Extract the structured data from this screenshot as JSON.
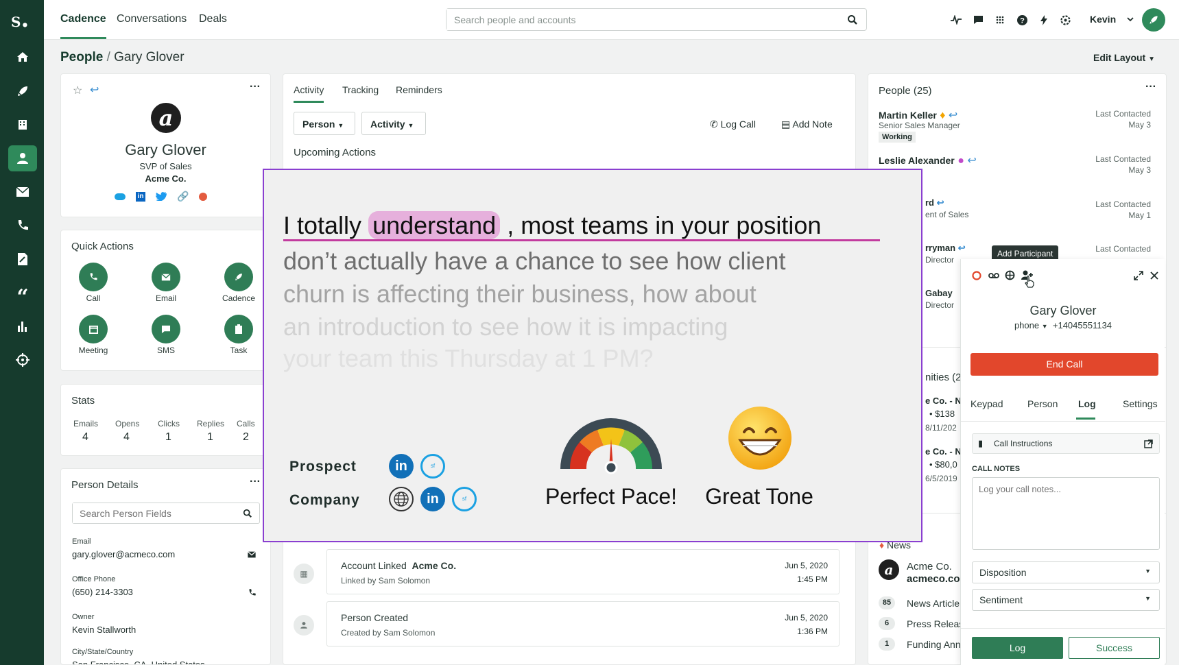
{
  "brand": {
    "logo": "S",
    "accent": "#2f8a5b",
    "sidebar": "#163b2d"
  },
  "topnav": {
    "tabs": [
      "Cadence",
      "Conversations",
      "Deals"
    ],
    "search_placeholder": "Search people and accounts",
    "user": "Kevin"
  },
  "breadcrumb": {
    "root": "People",
    "sep": "/",
    "current": "Gary Glover"
  },
  "edit_layout": "Edit Layout",
  "profile": {
    "name": "Gary Glover",
    "title": "SVP of Sales",
    "company": "Acme Co."
  },
  "quick_actions": {
    "title": "Quick Actions",
    "items": [
      "Call",
      "Email",
      "Cadence",
      "Meeting",
      "SMS",
      "Task"
    ]
  },
  "stats": {
    "title": "Stats",
    "items": [
      {
        "label": "Emails",
        "value": "4"
      },
      {
        "label": "Opens",
        "value": "4"
      },
      {
        "label": "Clicks",
        "value": "1"
      },
      {
        "label": "Replies",
        "value": "1"
      },
      {
        "label": "Calls",
        "value": "2"
      }
    ]
  },
  "person_details": {
    "title": "Person Details",
    "search_placeholder": "Search Person Fields",
    "fields": [
      {
        "label": "Email",
        "value": "gary.glover@acmeco.com"
      },
      {
        "label": "Office Phone",
        "value": "(650) 214-3303"
      },
      {
        "label": "Owner",
        "value": "Kevin Stallworth"
      },
      {
        "label": "City/State/Country",
        "value": "San Francisco, CA, United States"
      }
    ]
  },
  "activity": {
    "tabs": [
      "Activity",
      "Tracking",
      "Reminders"
    ],
    "filters": [
      "Person",
      "Activity"
    ],
    "log_call": "Log Call",
    "add_note": "Add Note",
    "upcoming": "Upcoming Actions",
    "feed": [
      {
        "title": "Account Linked",
        "entity": "Acme Co.",
        "sub": "Linked by Sam Solomon",
        "date": "Jun 5, 2020",
        "time": "1:45 PM"
      },
      {
        "title": "Person Created",
        "entity": "",
        "sub": "Created by Sam Solomon",
        "date": "Jun 5, 2020",
        "time": "1:36 PM"
      }
    ]
  },
  "people": {
    "title": "People (25)",
    "last_contacted": "Last Contacted",
    "items": [
      {
        "name": "Martin Keller",
        "role": "Senior Sales Manager",
        "badge": "Working",
        "date": "May 3"
      },
      {
        "name": "Leslie Alexander",
        "role": "",
        "badge": "",
        "date": "May 3"
      },
      {
        "name": "rd",
        "role": "ent of Sales",
        "badge": "",
        "date": "May 1"
      },
      {
        "name": "rryman",
        "role": "Director",
        "badge": "",
        "date": ""
      },
      {
        "name": "Gabay",
        "role": "Director",
        "badge": "",
        "date": ""
      }
    ]
  },
  "opps": {
    "title": "nities (2)",
    "items": [
      {
        "name": "e Co. - N",
        "amount": "$138",
        "date": "8/11/202"
      },
      {
        "name": "e Co. - N",
        "amount": "$80,0",
        "date": "6/5/2019"
      }
    ]
  },
  "news": {
    "title": "News",
    "company": "Acme Co.",
    "domain": "acmeco.co",
    "items": [
      {
        "count": "85",
        "label": "News Article"
      },
      {
        "count": "6",
        "label": "Press Releas"
      },
      {
        "count": "1",
        "label": "Funding Ann"
      }
    ]
  },
  "tooltip": "Add Participant",
  "call": {
    "name": "Gary Glover",
    "phone_type": "phone",
    "number": "+14045551134",
    "end": "End Call",
    "tabs": [
      "Keypad",
      "Person",
      "Log",
      "Settings"
    ],
    "instructions": "Call Instructions",
    "notes_label": "CALL NOTES",
    "notes_placeholder": "Log your call notes...",
    "disposition": "Disposition",
    "sentiment": "Sentiment",
    "log": "Log",
    "success": "Success"
  },
  "coach": {
    "line1_a": "I totally",
    "line1_b": "understand",
    "line1_c": ", most teams in your position",
    "line2": "don’t actually have a chance to see how client",
    "line3": "churn is affecting their business, how about",
    "line4": "an introduction to see how it is impacting",
    "line5": "your team this Thursday at 1 PM?",
    "prospect": "Prospect",
    "company": "Company",
    "pace": "Perfect Pace!",
    "tone": "Great Tone",
    "pace_level": 0.5
  }
}
